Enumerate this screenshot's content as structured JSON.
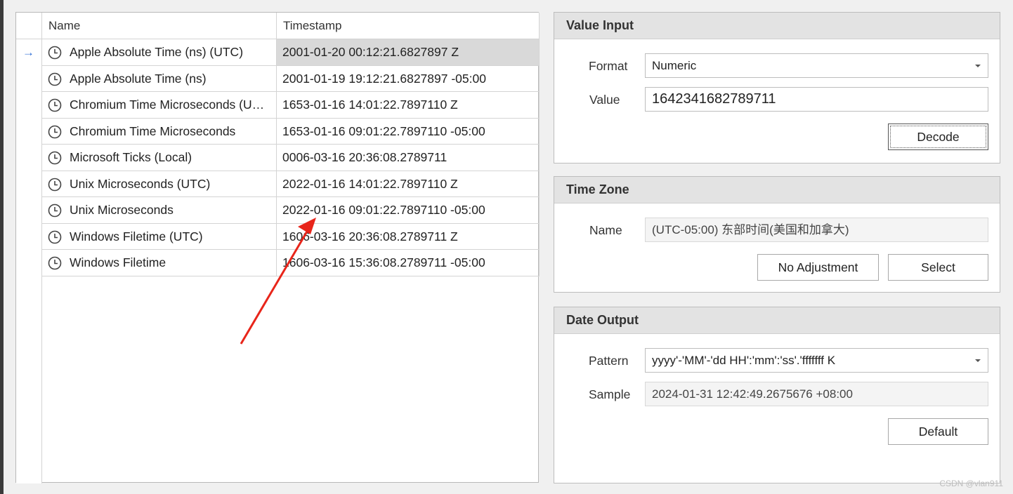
{
  "grid": {
    "columns": {
      "name": "Name",
      "timestamp": "Timestamp"
    },
    "rows": [
      {
        "name": "Apple Absolute Time (ns) (UTC)",
        "timestamp": "2001-01-20 00:12:21.6827897 Z",
        "selected": true
      },
      {
        "name": "Apple Absolute Time (ns)",
        "timestamp": "2001-01-19 19:12:21.6827897 -05:00"
      },
      {
        "name": "Chromium Time Microseconds (U…",
        "timestamp": "1653-01-16 14:01:22.7897110 Z"
      },
      {
        "name": "Chromium Time Microseconds",
        "timestamp": "1653-01-16 09:01:22.7897110 -05:00"
      },
      {
        "name": "Microsoft Ticks (Local)",
        "timestamp": "0006-03-16 20:36:08.2789711"
      },
      {
        "name": "Unix Microseconds (UTC)",
        "timestamp": "2022-01-16 14:01:22.7897110 Z"
      },
      {
        "name": "Unix Microseconds",
        "timestamp": "2022-01-16 09:01:22.7897110 -05:00"
      },
      {
        "name": "Windows Filetime (UTC)",
        "timestamp": "1606-03-16 20:36:08.2789711 Z"
      },
      {
        "name": "Windows Filetime",
        "timestamp": "1606-03-16 15:36:08.2789711 -05:00"
      }
    ],
    "row_icon": "clock-icon",
    "indicator_icon": "arrow-right-icon"
  },
  "value_input": {
    "title": "Value Input",
    "format_label": "Format",
    "format_value": "Numeric",
    "value_label": "Value",
    "value": "1642341682789711",
    "decode_label": "Decode"
  },
  "time_zone": {
    "title": "Time Zone",
    "name_label": "Name",
    "name_value": "(UTC-05:00) 东部时间(美国和加拿大)",
    "no_adjustment_label": "No Adjustment",
    "select_label": "Select"
  },
  "date_output": {
    "title": "Date Output",
    "pattern_label": "Pattern",
    "pattern_value": "yyyy'-'MM'-'dd HH':'mm':'ss'.'fffffff K",
    "sample_label": "Sample",
    "sample_value": "2024-01-31 12:42:49.2675676 +08:00",
    "default_label": "Default"
  },
  "watermark": "CSDN @vlan911",
  "colors": {
    "annotation_arrow": "#e8251a",
    "selection": "#d9d9d9",
    "indicator": "#2f6fd6"
  }
}
